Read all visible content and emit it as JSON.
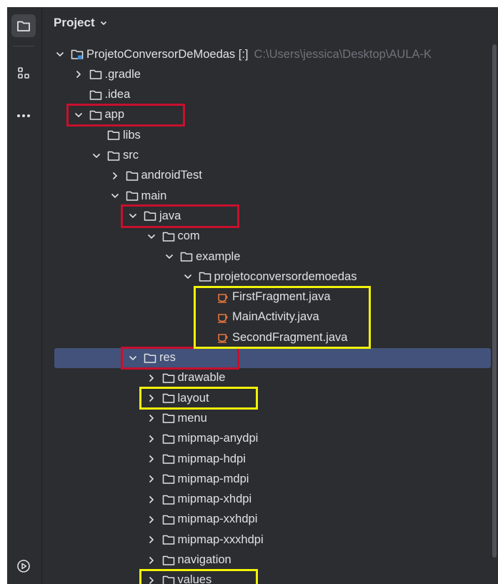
{
  "panel": {
    "title": "Project"
  },
  "toolstrip": {
    "buttons": [
      {
        "icon": "folder-icon",
        "active": true
      },
      {
        "icon": "structure-icon",
        "active": false
      },
      {
        "icon": "more-icon",
        "active": false
      }
    ],
    "bottom_icon": "run-icon"
  },
  "tree": [
    {
      "label": "ProjetoConversorDeMoedas [:]",
      "path": "C:\\Users\\jessica\\Desktop\\AULA-K",
      "depth": 0,
      "chevron": "down",
      "icon": "module"
    },
    {
      "label": ".gradle",
      "depth": 1,
      "chevron": "right",
      "icon": "folder"
    },
    {
      "label": ".idea",
      "depth": 1,
      "chevron": "none",
      "icon": "folder"
    },
    {
      "label": "app",
      "depth": 1,
      "chevron": "down",
      "icon": "folder"
    },
    {
      "label": "libs",
      "depth": 2,
      "chevron": "none",
      "icon": "folder"
    },
    {
      "label": "src",
      "depth": 2,
      "chevron": "down",
      "icon": "folder"
    },
    {
      "label": "androidTest",
      "depth": 3,
      "chevron": "right",
      "icon": "folder"
    },
    {
      "label": "main",
      "depth": 3,
      "chevron": "down",
      "icon": "folder"
    },
    {
      "label": "java",
      "depth": 4,
      "chevron": "down",
      "icon": "folder"
    },
    {
      "label": "com",
      "depth": 5,
      "chevron": "down",
      "icon": "folder"
    },
    {
      "label": "example",
      "depth": 6,
      "chevron": "down",
      "icon": "folder"
    },
    {
      "label": "projetoconversordemoedas",
      "depth": 7,
      "chevron": "down",
      "icon": "folder"
    },
    {
      "label": "FirstFragment.java",
      "depth": 8,
      "chevron": "none",
      "icon": "java"
    },
    {
      "label": "MainActivity.java",
      "depth": 8,
      "chevron": "none",
      "icon": "java"
    },
    {
      "label": "SecondFragment.java",
      "depth": 8,
      "chevron": "none",
      "icon": "java"
    },
    {
      "label": "res",
      "depth": 4,
      "chevron": "down",
      "icon": "folder",
      "selected": true
    },
    {
      "label": "drawable",
      "depth": 5,
      "chevron": "right",
      "icon": "folder"
    },
    {
      "label": "layout",
      "depth": 5,
      "chevron": "right",
      "icon": "folder"
    },
    {
      "label": "menu",
      "depth": 5,
      "chevron": "right",
      "icon": "folder"
    },
    {
      "label": "mipmap-anydpi",
      "depth": 5,
      "chevron": "right",
      "icon": "folder"
    },
    {
      "label": "mipmap-hdpi",
      "depth": 5,
      "chevron": "right",
      "icon": "folder"
    },
    {
      "label": "mipmap-mdpi",
      "depth": 5,
      "chevron": "right",
      "icon": "folder"
    },
    {
      "label": "mipmap-xhdpi",
      "depth": 5,
      "chevron": "right",
      "icon": "folder"
    },
    {
      "label": "mipmap-xxhdpi",
      "depth": 5,
      "chevron": "right",
      "icon": "folder"
    },
    {
      "label": "mipmap-xxxhdpi",
      "depth": 5,
      "chevron": "right",
      "icon": "folder"
    },
    {
      "label": "navigation",
      "depth": 5,
      "chevron": "right",
      "icon": "folder"
    },
    {
      "label": "values",
      "depth": 5,
      "chevron": "right",
      "icon": "folder"
    }
  ],
  "highlights": {
    "red": [
      "app",
      "java",
      "res"
    ],
    "yellow": [
      "java-files",
      "layout",
      "values"
    ],
    "red_color": "#c8102e",
    "yellow_color": "#f2f20a"
  },
  "colors": {
    "background": "#2b2d30",
    "text": "#dfe1e5",
    "path": "#6f737a",
    "selected": "#43527a",
    "java_icon": "#e8733c"
  }
}
